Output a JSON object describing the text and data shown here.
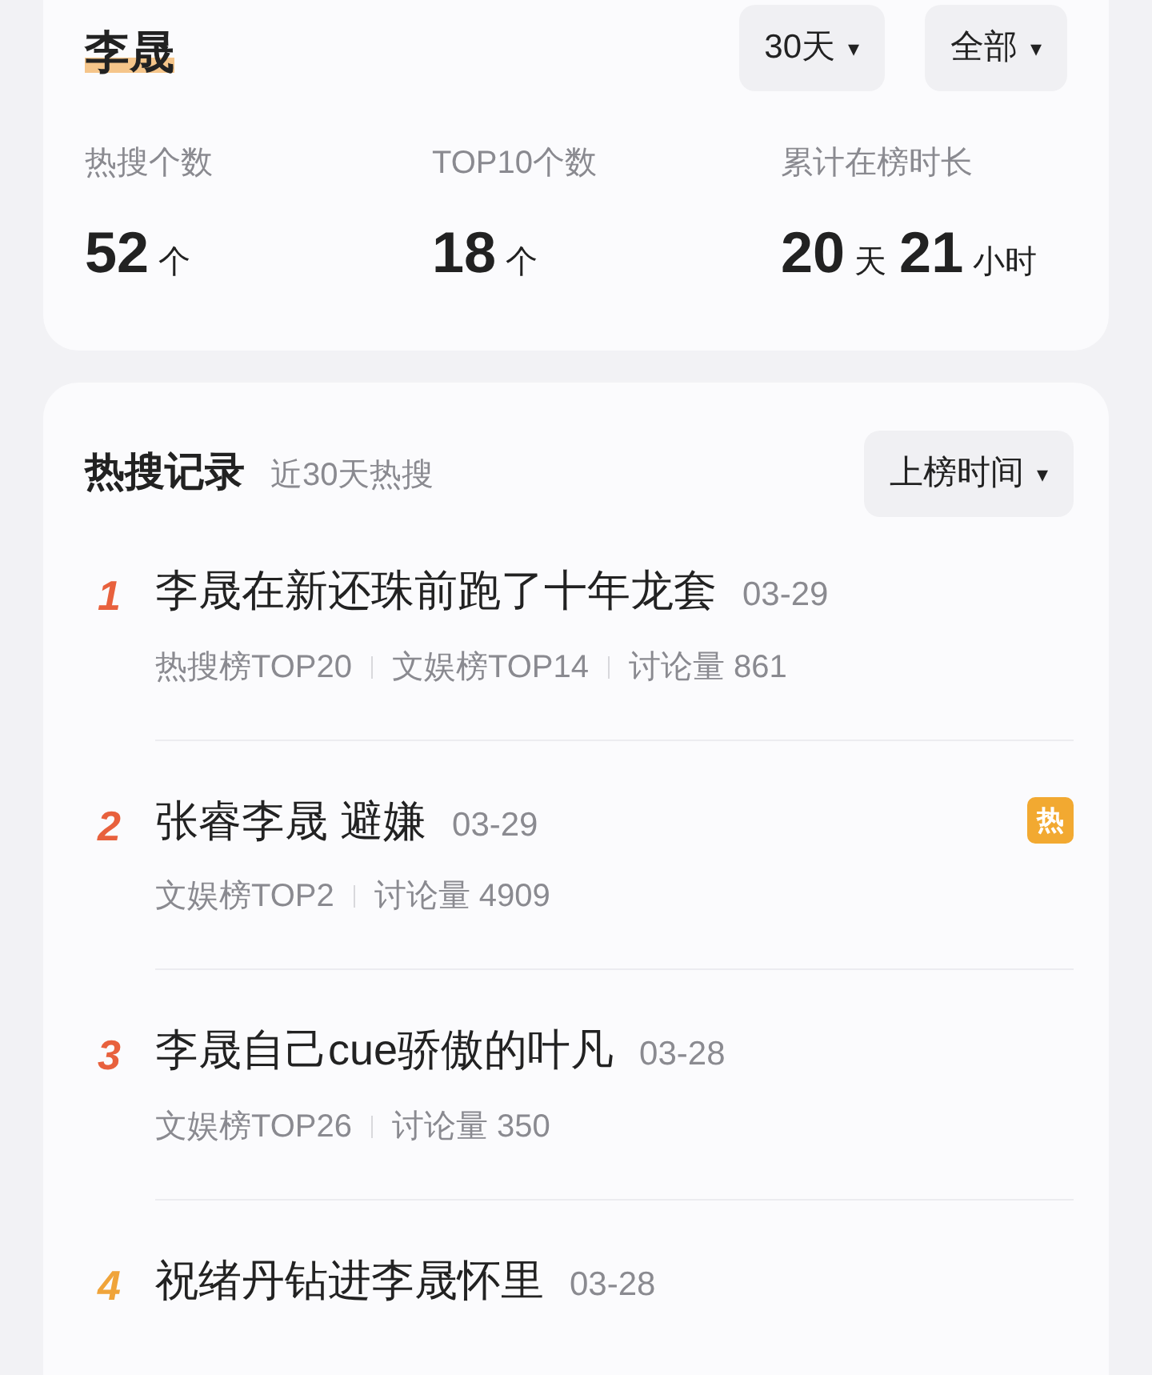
{
  "profile": {
    "name": "李晟",
    "filters": [
      {
        "label": "30天",
        "caret": "▾"
      },
      {
        "label": "全部",
        "caret": "▾"
      }
    ],
    "stats": [
      {
        "label": "热搜个数",
        "parts": [
          {
            "value": "52",
            "unit": "个"
          }
        ]
      },
      {
        "label": "TOP10个数",
        "parts": [
          {
            "value": "18",
            "unit": "个"
          }
        ]
      },
      {
        "label": "累计在榜时长",
        "parts": [
          {
            "value": "20",
            "unit": "天"
          },
          {
            "value": "21",
            "unit": "小时"
          }
        ]
      }
    ]
  },
  "records": {
    "title": "热搜记录",
    "subtitle": "近30天热搜",
    "sort": {
      "label": "上榜时间",
      "caret": "▾"
    },
    "items": [
      {
        "rank": "1",
        "color": "#e8613d",
        "title": "李晟在新还珠前跑了十年龙套",
        "date": "03-29",
        "meta": [
          "热搜榜TOP20",
          "文娱榜TOP14",
          "讨论量 861"
        ]
      },
      {
        "rank": "2",
        "color": "#e8613d",
        "title": "张睿李晟 避嫌",
        "date": "03-29",
        "meta": [
          "文娱榜TOP2",
          "讨论量 4909"
        ],
        "badge": "热"
      },
      {
        "rank": "3",
        "color": "#e8613d",
        "title": "李晟自己cue骄傲的叶凡",
        "date": "03-28",
        "meta": [
          "文娱榜TOP26",
          "讨论量 350"
        ]
      },
      {
        "rank": "4",
        "color": "#f0a43a",
        "title": "祝绪丹钻进李晟怀里",
        "date": "03-28"
      }
    ]
  }
}
